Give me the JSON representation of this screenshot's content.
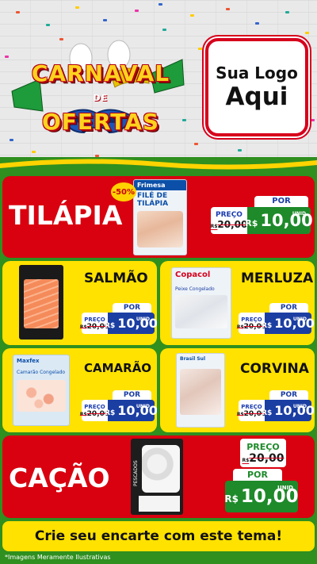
{
  "header": {
    "campaign_line1": "CARNAVAL",
    "campaign_connector": "DE",
    "campaign_line2": "OFERTAS",
    "logo_line1": "Sua Logo",
    "logo_line2": "Aqui"
  },
  "featured_top": {
    "name": "TILÁPIA",
    "badge": "-50%",
    "brand": "Frimesa",
    "package_text_1": "FILÉ DE",
    "package_text_2": "TILÁPIA",
    "por_label": "POR",
    "old_label": "PREÇO",
    "old_currency": "R$",
    "old_price": "20,00",
    "new_currency": "R$",
    "new_price": "10,00",
    "unit": "UNID"
  },
  "grid_items": [
    {
      "name": "SALMÃO",
      "old_label": "PREÇO",
      "old_currency": "R$",
      "old_price": "20,00",
      "por_label": "POR",
      "new_currency": "R$",
      "new_price": "10,00",
      "unit": "UNID"
    },
    {
      "name": "MERLUZA",
      "brand": "Copacol",
      "package_caption": "Peixe Congelado",
      "old_label": "PREÇO",
      "old_currency": "R$",
      "old_price": "20,00",
      "por_label": "POR",
      "new_currency": "R$",
      "new_price": "10,00",
      "unit": "UNID"
    },
    {
      "name": "CAMARÃO",
      "brand": "Maxfex",
      "package_caption": "Camarão Congelado",
      "old_label": "PREÇO",
      "old_currency": "R$",
      "old_price": "20,00",
      "por_label": "POR",
      "new_currency": "R$",
      "new_price": "10,00",
      "unit": "UNID"
    },
    {
      "name": "CORVINA",
      "brand": "Brasil Sul",
      "old_label": "PREÇO",
      "old_currency": "R$",
      "old_price": "20,00",
      "por_label": "POR",
      "new_currency": "R$",
      "new_price": "10,00",
      "unit": "UNID"
    }
  ],
  "featured_bottom": {
    "name": "CAÇÃO",
    "package_text": "PESCADOS",
    "old_label": "PREÇO",
    "old_currency": "R$",
    "old_price": "20,00",
    "por_label": "POR",
    "new_currency": "R$",
    "new_price": "10,00",
    "unit": "UNID"
  },
  "footer": {
    "cta": "Crie seu encarte com este tema!",
    "disclaimer": "*Imagens Meramente Ilustrativas"
  },
  "colors": {
    "red": "#d9000f",
    "yellow": "#ffe200",
    "green": "#2f8f1f",
    "blue": "#1b3ea3"
  }
}
